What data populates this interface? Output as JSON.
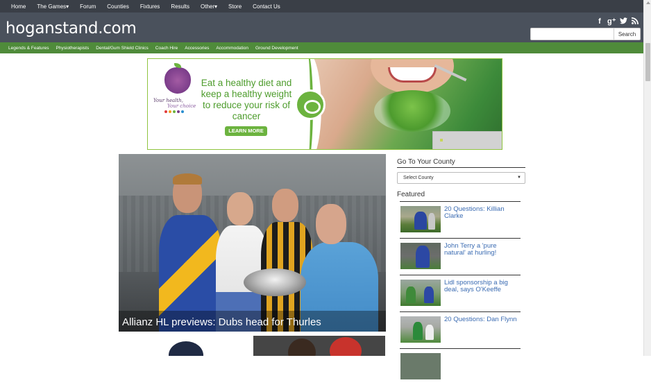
{
  "topnav": {
    "items": [
      "Home",
      "The Games",
      "Forum",
      "Counties",
      "Fixtures",
      "Results",
      "Other",
      "Store",
      "Contact Us"
    ],
    "dropdown_flags": [
      false,
      true,
      false,
      false,
      false,
      false,
      true,
      false,
      false
    ]
  },
  "header": {
    "logo": "hoganstand.com",
    "search_placeholder": "",
    "search_button": "Search",
    "social_icons": [
      "facebook-icon",
      "google-plus-icon",
      "twitter-icon",
      "rss-icon"
    ]
  },
  "subnav": {
    "items": [
      "Legends & Features",
      "Physiotherapists",
      "Dental/Gum Shield Clinics",
      "Coach Hire",
      "Accessories",
      "Accommodation",
      "Ground Development"
    ]
  },
  "advert": {
    "logo_line1": "Your health,",
    "logo_line2": "Your choice",
    "headline": "Eat a healthy diet and keep a healthy weight to reduce your risk of cancer",
    "cta": "LEARN MORE"
  },
  "hero": {
    "caption": "Allianz HL previews: Dubs head for Thurles"
  },
  "sidebar": {
    "county_heading": "Go To Your County",
    "county_select": "Select County",
    "featured_heading": "Featured",
    "featured": [
      {
        "title": "20 Questions: Killian Clarke"
      },
      {
        "title": "John Terry a 'pure natural' at hurling!"
      },
      {
        "title": "Lidl sponsorship a big deal, says O'Keeffe"
      },
      {
        "title": "20 Questions: Dan Flynn"
      }
    ]
  },
  "colors": {
    "topnav_bg": "#3a3f47",
    "header_bg": "#4a515c",
    "subnav_bg": "#4f8b3a",
    "link": "#3a6bb2",
    "ad_green": "#6cb33f"
  }
}
